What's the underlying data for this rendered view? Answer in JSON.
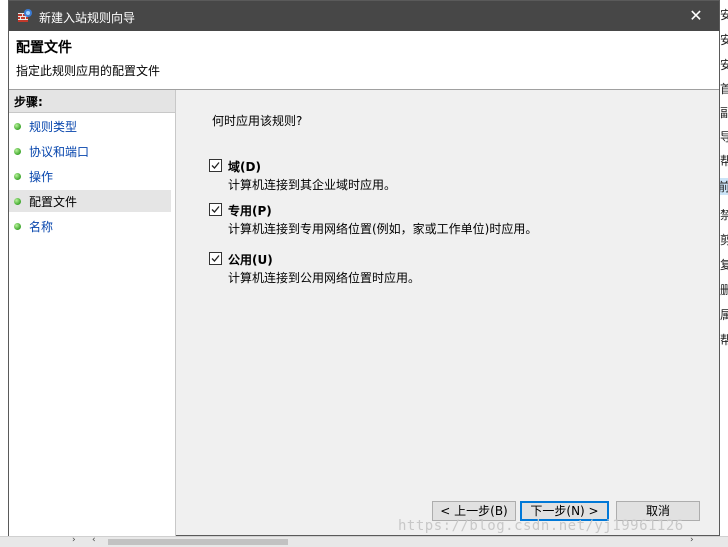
{
  "window": {
    "title": "新建入站规则向导",
    "close_glyph": "✕"
  },
  "header": {
    "title": "配置文件",
    "subtitle": "指定此规则应用的配置文件"
  },
  "sidebar": {
    "title": "步骤:",
    "steps": [
      {
        "label": "规则类型"
      },
      {
        "label": "协议和端口"
      },
      {
        "label": "操作"
      },
      {
        "label": "配置文件",
        "active": true
      },
      {
        "label": "名称"
      }
    ]
  },
  "main": {
    "question": "何时应用该规则?",
    "options": [
      {
        "label": "域(D)",
        "desc": "计算机连接到其企业域时应用。",
        "checked": true
      },
      {
        "label": "专用(P)",
        "desc": "计算机连接到专用网络位置(例如，家或工作单位)时应用。",
        "checked": true
      },
      {
        "label": "公用(U)",
        "desc": "计算机连接到公用网络位置时应用。",
        "checked": true
      }
    ]
  },
  "buttons": {
    "back": "< 上一步(B)",
    "next": "下一步(N) >",
    "cancel": "取消"
  },
  "background": {
    "right_chars": [
      "安",
      "安",
      "首",
      "副",
      "导",
      "帮",
      "前",
      "禁",
      "剪",
      "复",
      "删",
      "属",
      "帮"
    ],
    "bottom_left_arrow": "›",
    "bottom_right_arrow": "›",
    "bottom_left_arrow2": "‹"
  },
  "watermark": "https://blog.csdn.net/yj19961126",
  "colors": {
    "titlebar": "#474747",
    "accent": "#0078d7",
    "link": "#0645ad",
    "dot": "#3ea62c"
  }
}
